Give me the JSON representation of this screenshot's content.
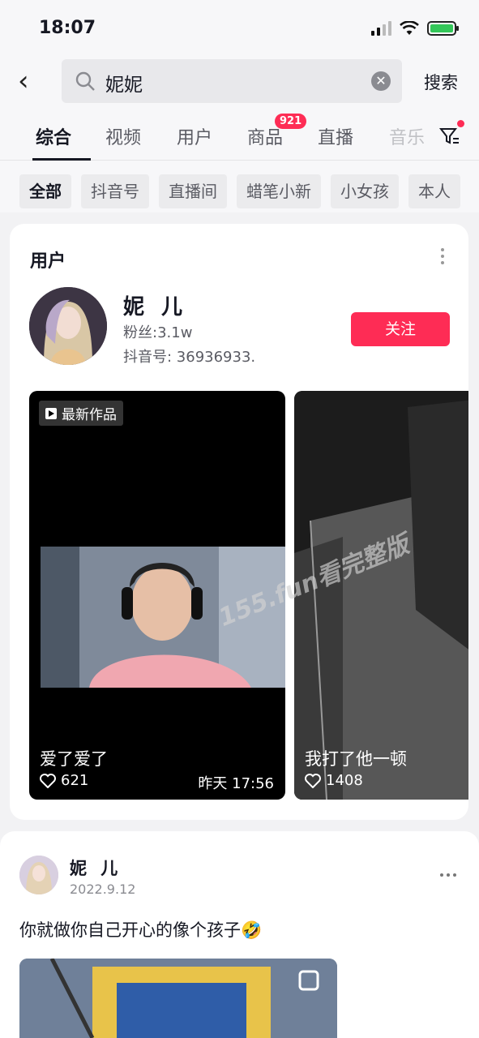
{
  "status_bar": {
    "time": "18:07"
  },
  "search": {
    "query": "妮妮",
    "button_label": "搜索"
  },
  "tabs": [
    {
      "label": "综合",
      "active": true
    },
    {
      "label": "视频"
    },
    {
      "label": "用户"
    },
    {
      "label": "商品",
      "badge": "921"
    },
    {
      "label": "直播"
    },
    {
      "label": "音乐"
    }
  ],
  "chips": [
    "全部",
    "抖音号",
    "直播间",
    "蜡笔小新",
    "小女孩",
    "本人"
  ],
  "user_card": {
    "title": "用户",
    "name": "妮 儿",
    "fans": "粉丝:3.1w",
    "douyin_id": "抖音号: 36936933.",
    "follow_label": "关注",
    "videos": [
      {
        "tag": "最新作品",
        "caption": "爱了爱了",
        "likes": "621",
        "time": "昨天 17:56"
      },
      {
        "caption": "我打了他一顿",
        "likes": "1408"
      }
    ]
  },
  "watermark": "155.fun看完整版",
  "post": {
    "author": "妮 儿",
    "date": "2022.9.12",
    "text": "你就做你自己开心的像个孩子🤣"
  },
  "colors": {
    "accent": "#fe2c55",
    "battery": "#34c759"
  },
  "icons": [
    "back-icon",
    "search-icon",
    "clear-icon",
    "filter-icon",
    "more-icon",
    "heart-icon",
    "play-icon"
  ]
}
